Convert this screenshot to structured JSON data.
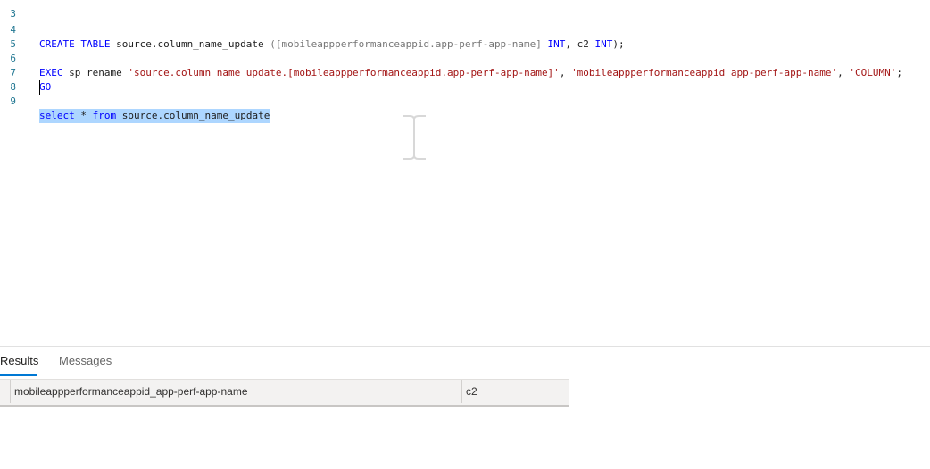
{
  "editor": {
    "lines": [
      {
        "num": "3"
      },
      {
        "num": "4",
        "parts": [
          {
            "t": "CREATE TABLE ",
            "c": "kw"
          },
          {
            "t": "source.column_name_update ",
            "c": "ident"
          },
          {
            "t": "([mobileappperformanceappid.app-perf-app-name] ",
            "c": "gray"
          },
          {
            "t": "INT",
            "c": "kw"
          },
          {
            "t": ", c2 ",
            "c": "ident"
          },
          {
            "t": "INT",
            "c": "kw"
          },
          {
            "t": ");",
            "c": "ident"
          }
        ]
      },
      {
        "num": "5"
      },
      {
        "num": "6",
        "parts": [
          {
            "t": "EXEC ",
            "c": "kw"
          },
          {
            "t": "sp_rename ",
            "c": "ident"
          },
          {
            "t": "'source.column_name_update.[mobileappperformanceappid.app-perf-app-name]'",
            "c": "str"
          },
          {
            "t": ", ",
            "c": "ident"
          },
          {
            "t": "'mobileappperformanceappid_app-perf-app-name'",
            "c": "str"
          },
          {
            "t": ", ",
            "c": "ident"
          },
          {
            "t": "'COLUMN'",
            "c": "str"
          },
          {
            "t": ";",
            "c": "ident"
          }
        ]
      },
      {
        "num": "7",
        "parts": [
          {
            "t": "GO",
            "c": "kw"
          }
        ]
      },
      {
        "num": "8"
      },
      {
        "num": "9",
        "selected": true,
        "parts": [
          {
            "t": "select",
            "c": "kw"
          },
          {
            "t": " * ",
            "c": "ident"
          },
          {
            "t": "from",
            "c": "kw"
          },
          {
            "t": " source.column_name_update",
            "c": "ident"
          }
        ]
      }
    ]
  },
  "results_panel": {
    "tabs": [
      {
        "label": "Results",
        "active": true
      },
      {
        "label": "Messages",
        "active": false
      }
    ],
    "columns": [
      "mobileappperformanceappid_app-perf-app-name",
      "c2"
    ]
  },
  "colors": {
    "keyword": "#0000ff",
    "string": "#a31515",
    "line_number": "#237893",
    "selection": "#add6ff",
    "accent": "#0078d4"
  }
}
